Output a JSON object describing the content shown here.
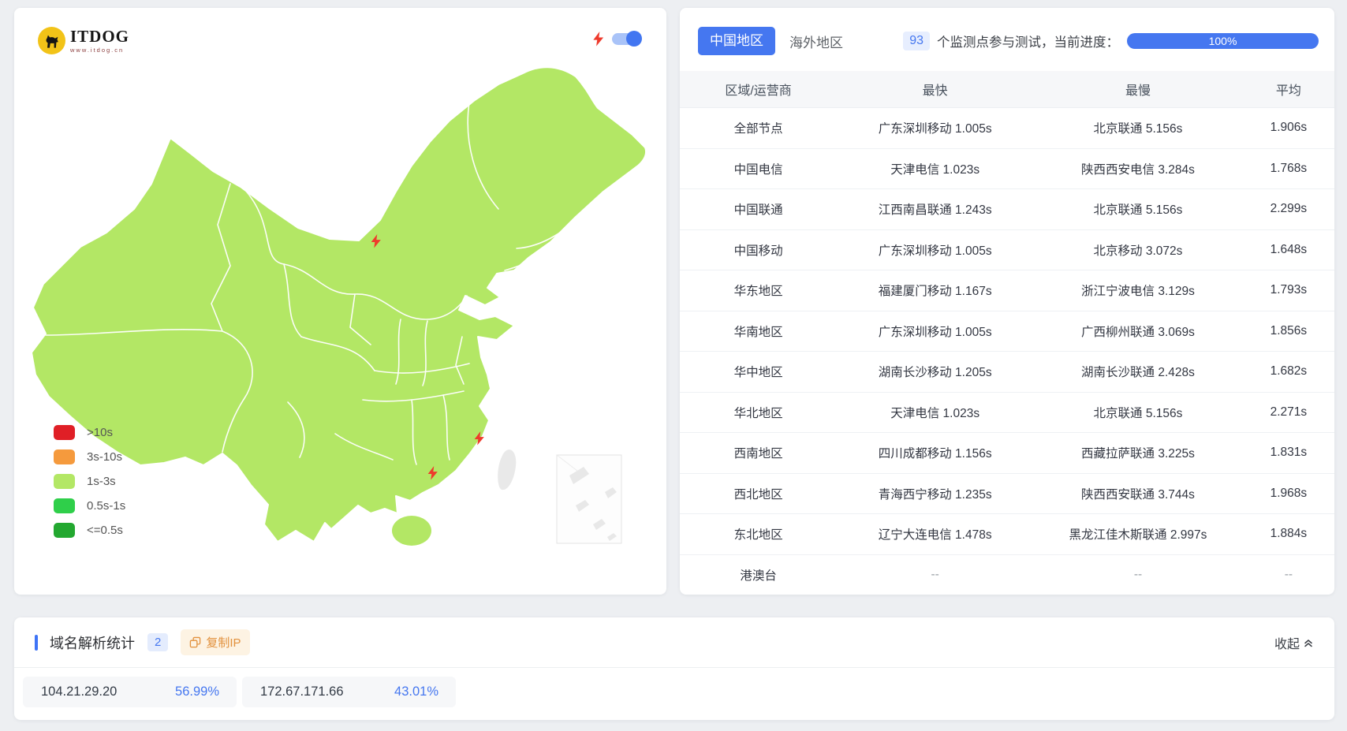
{
  "page": {
    "background": "#edeff2",
    "accent_blue": "#4577f0"
  },
  "map_panel": {
    "logo": {
      "title": "ITDOG",
      "subtitle": "www.itdog.cn"
    },
    "toggle_state": "on",
    "map_fill_color": "#b3e765",
    "no_data_color": "#e9e9e9",
    "marker_color": "#ee3a2c",
    "legend": [
      {
        "label": ">10s",
        "color": "#e01f26"
      },
      {
        "label": "3s-10s",
        "color": "#f59a3d"
      },
      {
        "label": "1s-3s",
        "color": "#b3e765"
      },
      {
        "label": "0.5s-1s",
        "color": "#2fcf4a"
      },
      {
        "label": "<=0.5s",
        "color": "#23a830"
      }
    ]
  },
  "results_panel": {
    "tabs": [
      {
        "label": "中国地区",
        "active": true
      },
      {
        "label": "海外地区",
        "active": false
      }
    ],
    "monitor_count": "93",
    "progress_text": "个监测点参与测试，当前进度：",
    "progress_value": "100%",
    "table": {
      "headers": [
        "区域/运营商",
        "最快",
        "最慢",
        "平均"
      ],
      "rows": [
        [
          "全部节点",
          "广东深圳移动 1.005s",
          "北京联通 5.156s",
          "1.906s"
        ],
        [
          "中国电信",
          "天津电信 1.023s",
          "陕西西安电信 3.284s",
          "1.768s"
        ],
        [
          "中国联通",
          "江西南昌联通 1.243s",
          "北京联通 5.156s",
          "2.299s"
        ],
        [
          "中国移动",
          "广东深圳移动 1.005s",
          "北京移动 3.072s",
          "1.648s"
        ],
        [
          "华东地区",
          "福建厦门移动 1.167s",
          "浙江宁波电信 3.129s",
          "1.793s"
        ],
        [
          "华南地区",
          "广东深圳移动 1.005s",
          "广西柳州联通 3.069s",
          "1.856s"
        ],
        [
          "华中地区",
          "湖南长沙移动 1.205s",
          "湖南长沙联通 2.428s",
          "1.682s"
        ],
        [
          "华北地区",
          "天津电信 1.023s",
          "北京联通 5.156s",
          "2.271s"
        ],
        [
          "西南地区",
          "四川成都移动 1.156s",
          "西藏拉萨联通 3.225s",
          "1.831s"
        ],
        [
          "西北地区",
          "青海西宁移动 1.235s",
          "陕西西安联通 3.744s",
          "1.968s"
        ],
        [
          "东北地区",
          "辽宁大连电信 1.478s",
          "黑龙江佳木斯联通 2.997s",
          "1.884s"
        ],
        [
          "港澳台",
          "--",
          "--",
          "--"
        ]
      ]
    }
  },
  "dns_panel": {
    "title": "域名解析统计",
    "count_badge": "2",
    "copy_ip_label": "复制IP",
    "collapse_label": "收起",
    "ips": [
      {
        "ip": "104.21.29.20",
        "percent": "56.99%"
      },
      {
        "ip": "172.67.171.66",
        "percent": "43.01%"
      }
    ]
  }
}
